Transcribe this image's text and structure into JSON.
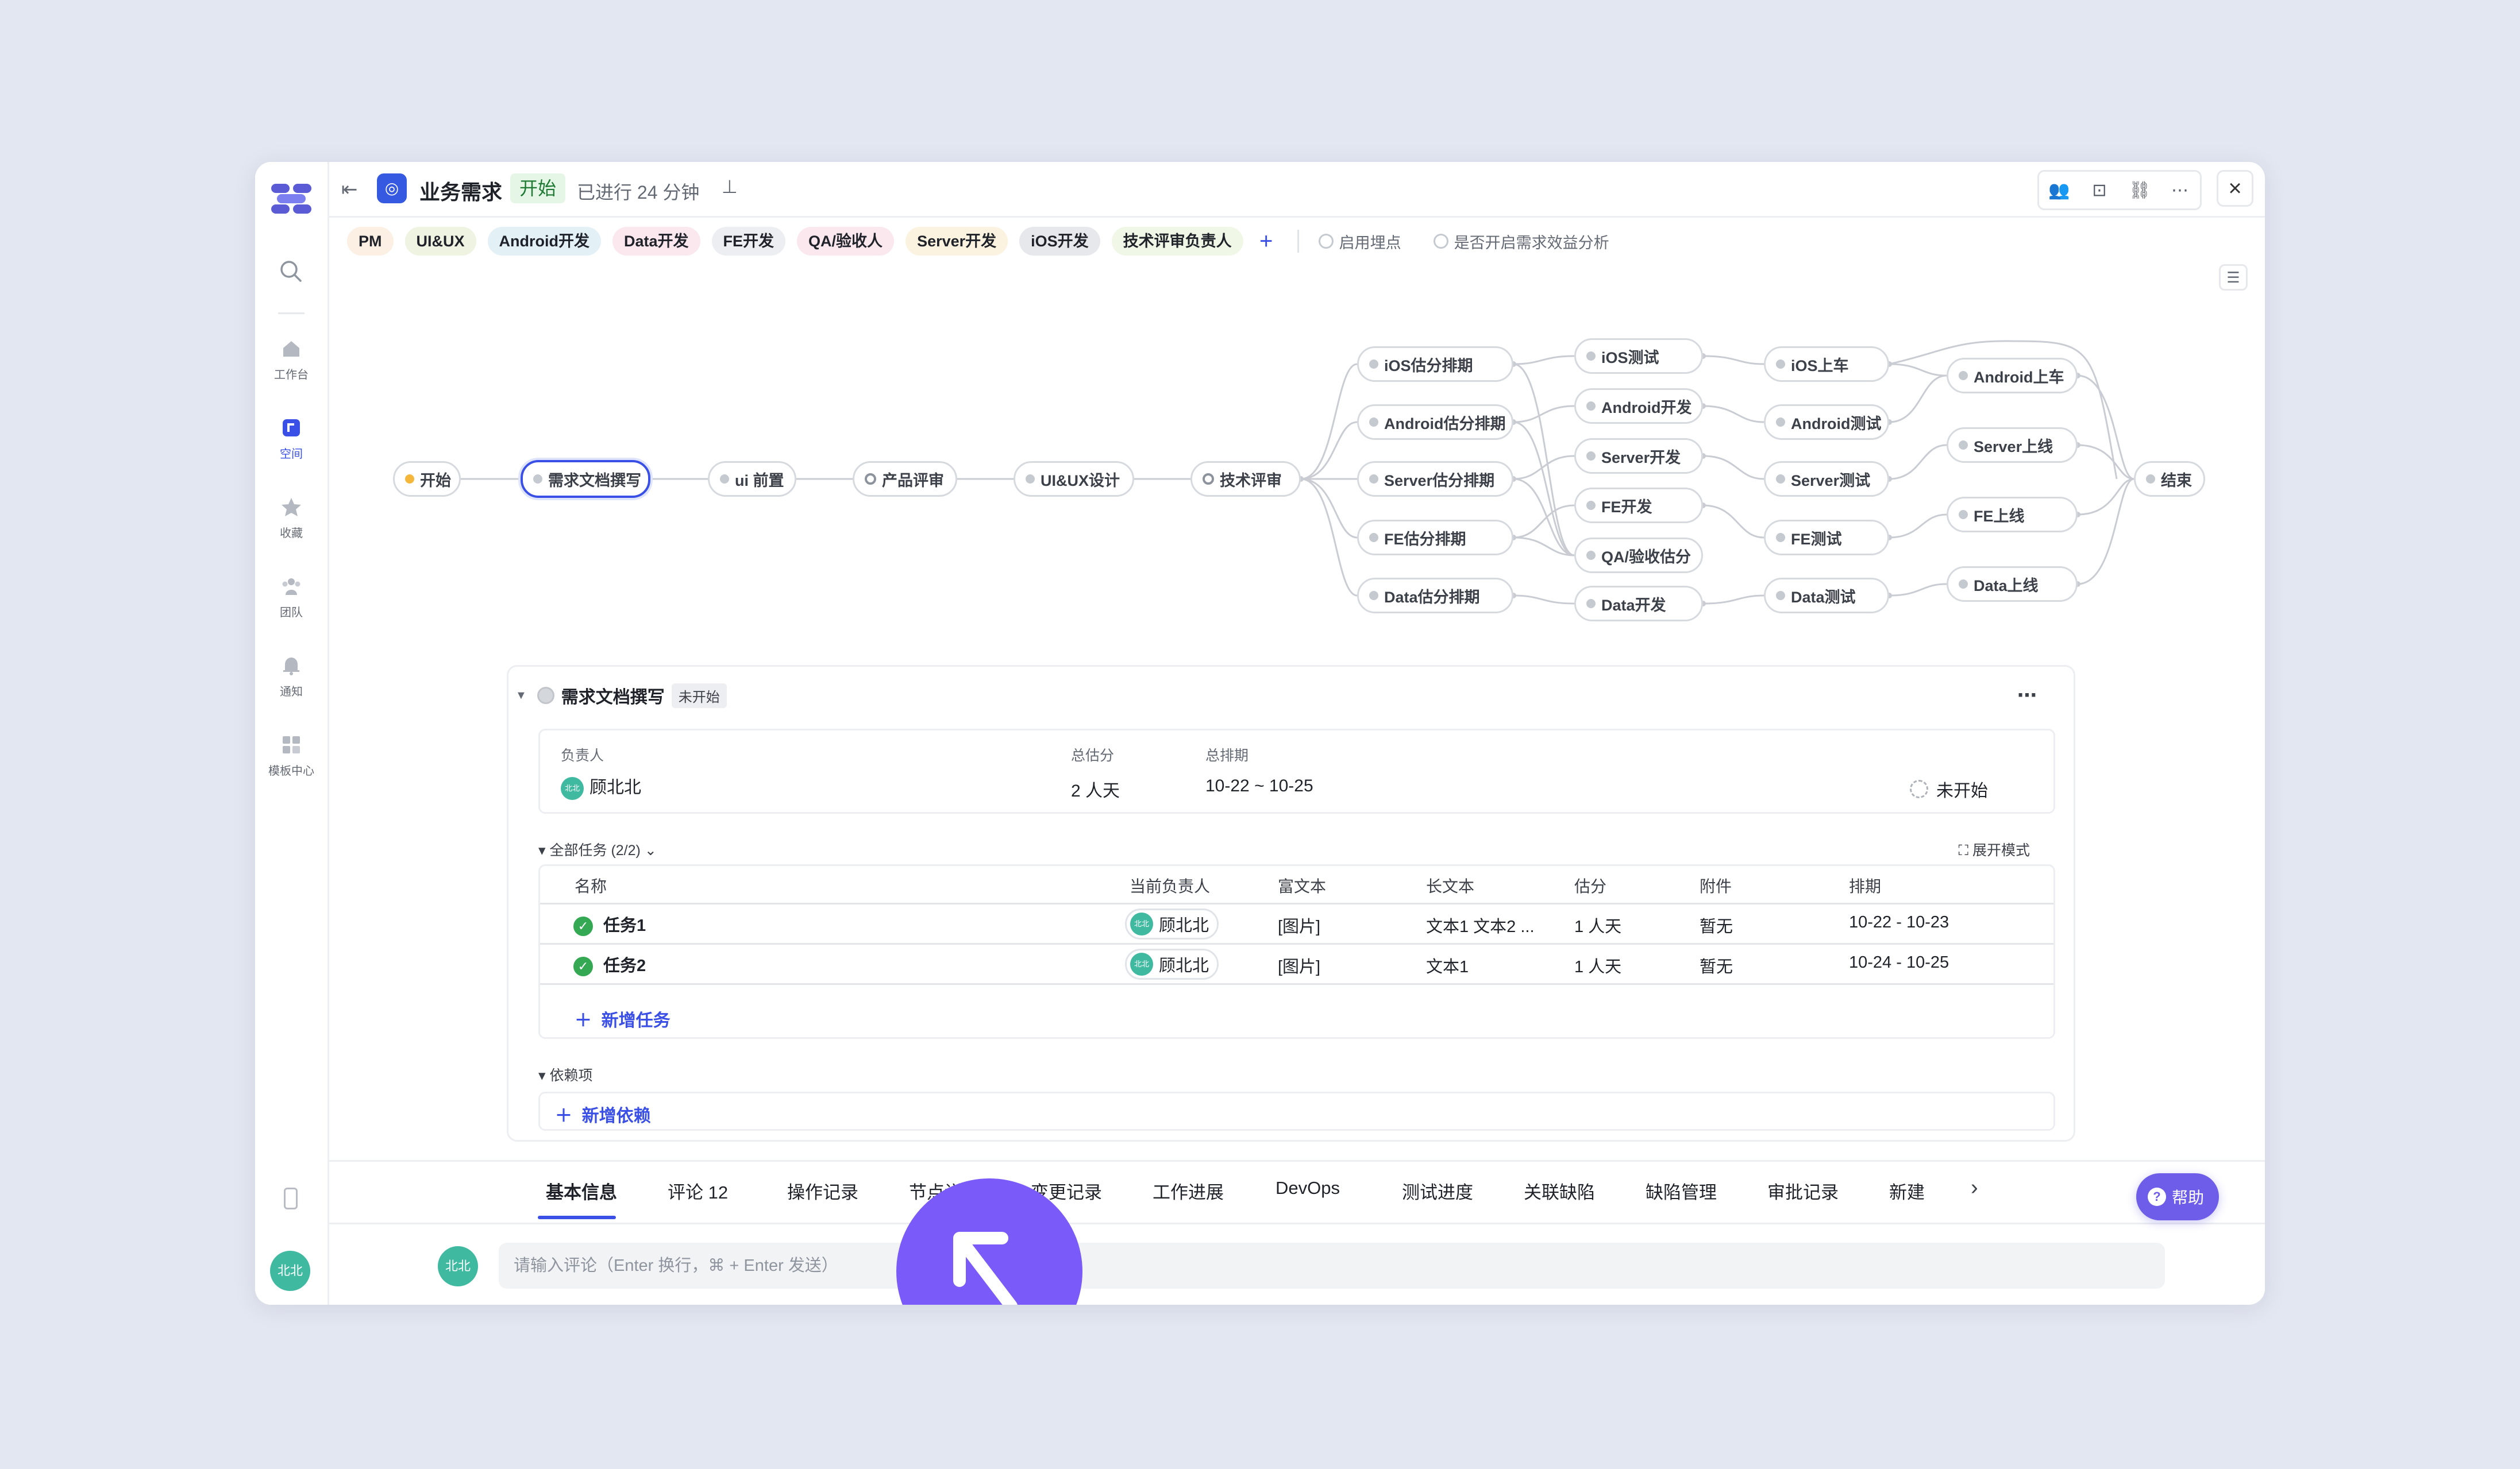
{
  "header": {
    "title": "业务需求",
    "status": "开始",
    "elapsed": "已进行 24 分钟"
  },
  "rail": {
    "items": [
      {
        "label": "工作台",
        "icon": "home-icon"
      },
      {
        "label": "空间",
        "icon": "space-icon"
      },
      {
        "label": "收藏",
        "icon": "star-icon"
      },
      {
        "label": "团队",
        "icon": "team-icon"
      },
      {
        "label": "通知",
        "icon": "bell-icon"
      },
      {
        "label": "模板中心",
        "icon": "grid-icon"
      }
    ],
    "avatar": "北北"
  },
  "roles": [
    "PM",
    "UI&UX",
    "Android开发",
    "Data开发",
    "FE开发",
    "QA/验收人",
    "Server开发",
    "iOS开发",
    "技术评审负责人"
  ],
  "role_colors": [
    "#fcefe3",
    "#eef3e2",
    "#e3f1f7",
    "#fbe7ee",
    "#eceef2",
    "#fbe7ee",
    "#fbf3df",
    "#e6e8ec",
    "#f1f7e6"
  ],
  "options": [
    "启用埋点",
    "是否开启需求效益分析"
  ],
  "flow": {
    "nodes": {
      "start": "开始",
      "doc": "需求文档撰写",
      "ui_pre": "ui 前置",
      "review": "产品评审",
      "uiux": "UI&UX设计",
      "tech": "技术评审",
      "ios_est": "iOS估分排期",
      "android_est": "Android估分排期",
      "server_est": "Server估分排期",
      "fe_est": "FE估分排期",
      "data_est": "Data估分排期",
      "ios_test": "iOS测试",
      "android_dev": "Android开发",
      "server_dev": "Server开发",
      "fe_dev": "FE开发",
      "qa_est": "QA/验收估分",
      "data_dev": "Data开发",
      "ios_car": "iOS上车",
      "android_test": "Android测试",
      "server_test": "Server测试",
      "fe_test": "FE测试",
      "data_test": "Data测试",
      "android_car": "Android上车",
      "server_online": "Server上线",
      "fe_online": "FE上线",
      "data_online": "Data上线",
      "end": "结束"
    }
  },
  "panel": {
    "title": "需求文档撰写",
    "badge": "未开始",
    "owner_label": "负责人",
    "owner": "顾北北",
    "owner_avatar": "北北",
    "estimate_label": "总估分",
    "estimate": "2 人天",
    "schedule_label": "总排期",
    "schedule": "10-22 ~ 10-25",
    "state": "未开始",
    "tasks_header": "全部任务 (2/2)",
    "expand_mode": "展开模式",
    "columns": [
      "名称",
      "当前负责人",
      "富文本",
      "长文本",
      "估分",
      "附件",
      "排期"
    ],
    "rows": [
      {
        "name": "任务1",
        "owner": "顾北北",
        "rich": "[图片]",
        "long": "文本1 文本2 ...",
        "estimate": "1 人天",
        "attach": "暂无",
        "schedule": "10-22 - 10-23"
      },
      {
        "name": "任务2",
        "owner": "顾北北",
        "rich": "[图片]",
        "long": "文本1",
        "estimate": "1 人天",
        "attach": "暂无",
        "schedule": "10-24 - 10-25"
      }
    ],
    "add_task": "新增任务",
    "deps_header": "依赖项",
    "add_dep": "新增依赖"
  },
  "tabs": [
    "基本信息",
    "评论 12",
    "操作记录",
    "节点详情",
    "变更记录",
    "工作进展",
    "DevOps",
    "测试进度",
    "关联缺陷",
    "缺陷管理",
    "审批记录",
    "新建"
  ],
  "help": "帮助",
  "comment": {
    "avatar": "北北",
    "placeholder": "请输入评论（Enter 换行，⌘ + Enter 发送）"
  },
  "colors": {
    "accent": "#3a4fe5",
    "cursor": "#7a5af8",
    "success": "#34a853"
  }
}
